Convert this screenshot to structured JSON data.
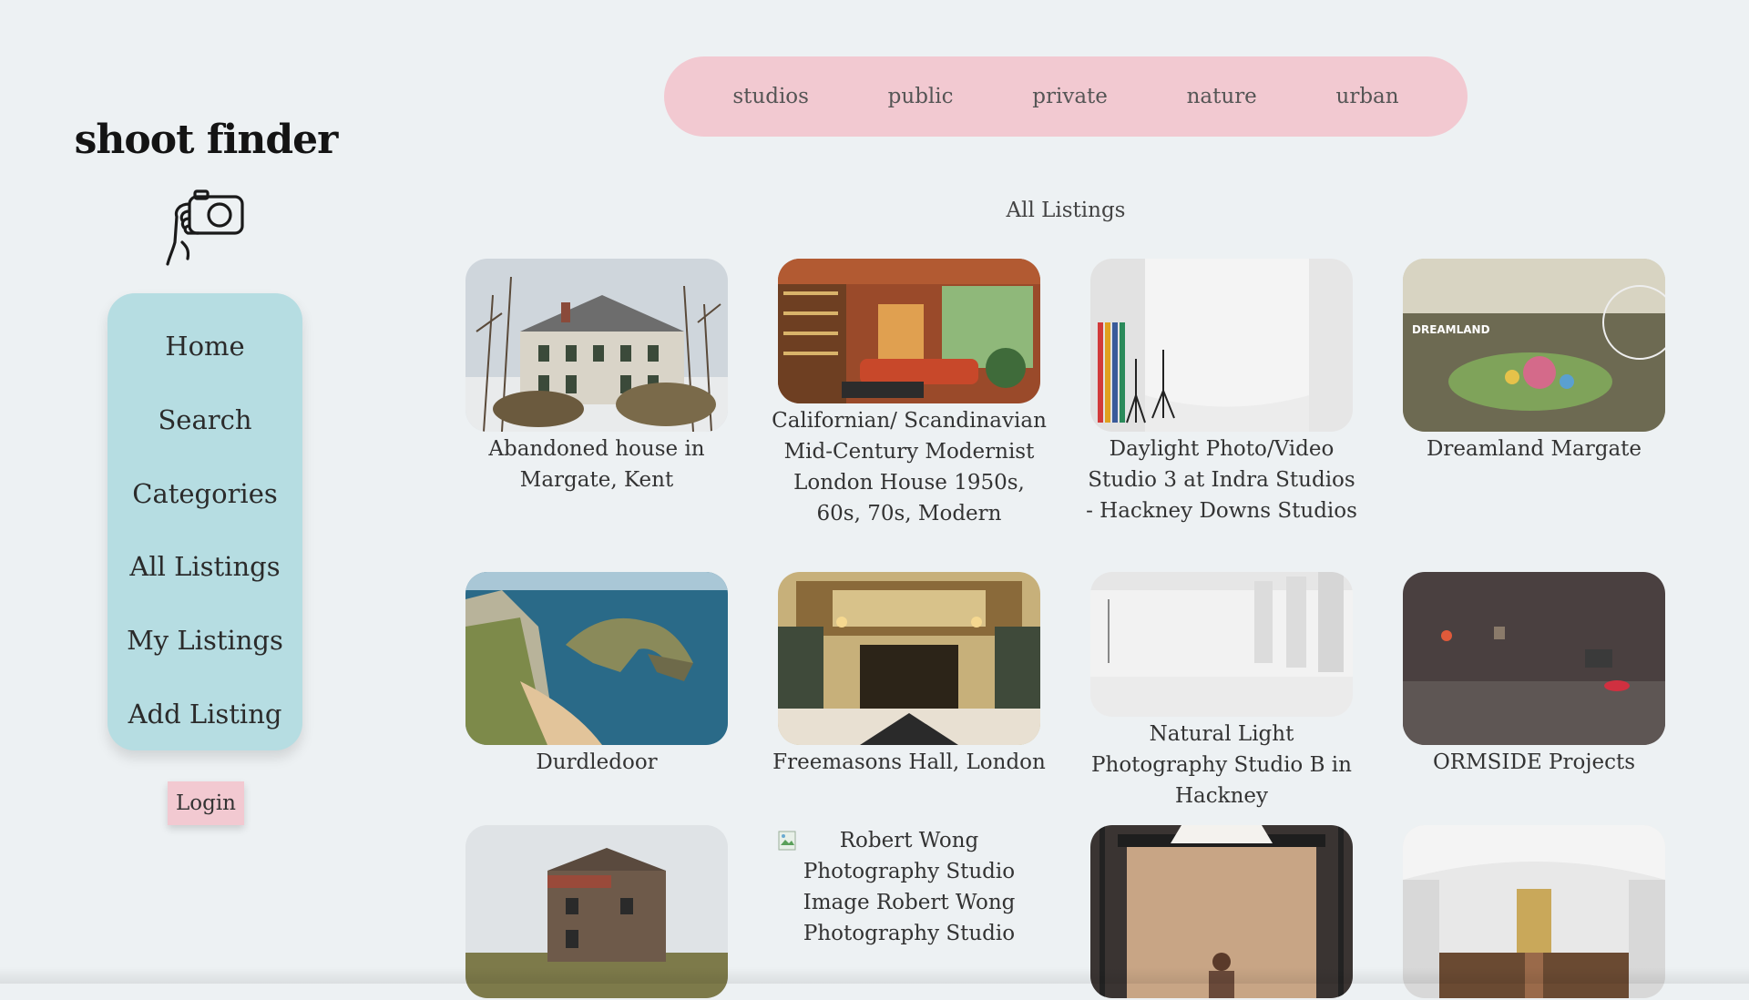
{
  "app": {
    "title": "shoot finder"
  },
  "sidebar": {
    "items": [
      {
        "label": "Home"
      },
      {
        "label": "Search"
      },
      {
        "label": "Categories"
      },
      {
        "label": "All Listings"
      },
      {
        "label": "My Listings"
      },
      {
        "label": "Add Listing"
      }
    ],
    "login_label": "Login"
  },
  "categories": {
    "items": [
      {
        "label": "studios"
      },
      {
        "label": "public"
      },
      {
        "label": "private"
      },
      {
        "label": "nature"
      },
      {
        "label": "urban"
      }
    ]
  },
  "main": {
    "section_title": "All Listings",
    "listings": [
      {
        "caption": "Abandoned house in Margate, Kent"
      },
      {
        "caption": "Californian/ Scandinavian Mid-Century Modernist London House 1950s, 60s, 70s, Modern"
      },
      {
        "caption": "Daylight Photo/Video Studio 3 at Indra Studios - Hackney Downs Studios"
      },
      {
        "caption": "Dreamland Margate"
      },
      {
        "caption": "Durdledoor"
      },
      {
        "caption": "Freemasons Hall, London"
      },
      {
        "caption": "Natural Light Photography Studio B in Hackney"
      },
      {
        "caption": "ORMSIDE Projects"
      },
      {
        "caption": ""
      },
      {
        "caption": "Robert Wong Photography Studio Image Robert Wong Photography Studio"
      },
      {
        "caption": ""
      },
      {
        "caption": ""
      }
    ]
  },
  "colors": {
    "background": "#edf1f3",
    "nav_panel": "#b6dde2",
    "accent_pink": "#f2c9d1"
  }
}
